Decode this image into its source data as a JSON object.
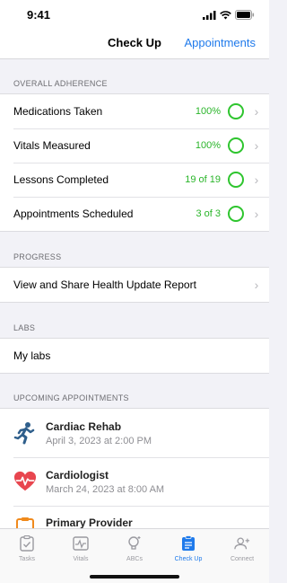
{
  "status": {
    "time": "9:41"
  },
  "nav": {
    "title": "Check Up",
    "action": "Appointments"
  },
  "adherence": {
    "header": "OVERALL ADHERENCE",
    "rows": [
      {
        "label": "Medications Taken",
        "value": "100%"
      },
      {
        "label": "Vitals Measured",
        "value": "100%"
      },
      {
        "label": "Lessons Completed",
        "value": "19 of 19"
      },
      {
        "label": "Appointments Scheduled",
        "value": "3 of 3"
      }
    ]
  },
  "progress": {
    "header": "PROGRESS",
    "item": "View and Share Health Update Report"
  },
  "labs": {
    "header": "LABS",
    "item": "My labs"
  },
  "appointments": {
    "header": "UPCOMING APPOINTMENTS",
    "items": [
      {
        "name": "Cardiac Rehab",
        "date": "April 3, 2023 at 2:00 PM",
        "icon": "runner-icon"
      },
      {
        "name": "Cardiologist",
        "date": "March 24, 2023 at 8:00 AM",
        "icon": "heart-pulse-icon"
      },
      {
        "name": "Primary Provider",
        "date": "",
        "icon": "clipboard-icon"
      }
    ]
  },
  "tabs": [
    {
      "label": "Tasks",
      "icon": "tasks-icon",
      "active": false
    },
    {
      "label": "Vitals",
      "icon": "vitals-icon",
      "active": false
    },
    {
      "label": "ABCs",
      "icon": "lightbulb-icon",
      "active": false
    },
    {
      "label": "Check Up",
      "icon": "checkup-icon",
      "active": true
    },
    {
      "label": "Connect",
      "icon": "add-person-icon",
      "active": false
    }
  ],
  "colors": {
    "accent": "#1f7aeb",
    "success": "#2ec52e",
    "heart": "#e8464f",
    "runner": "#2f5f8c",
    "clipboard": "#f08a1c"
  }
}
